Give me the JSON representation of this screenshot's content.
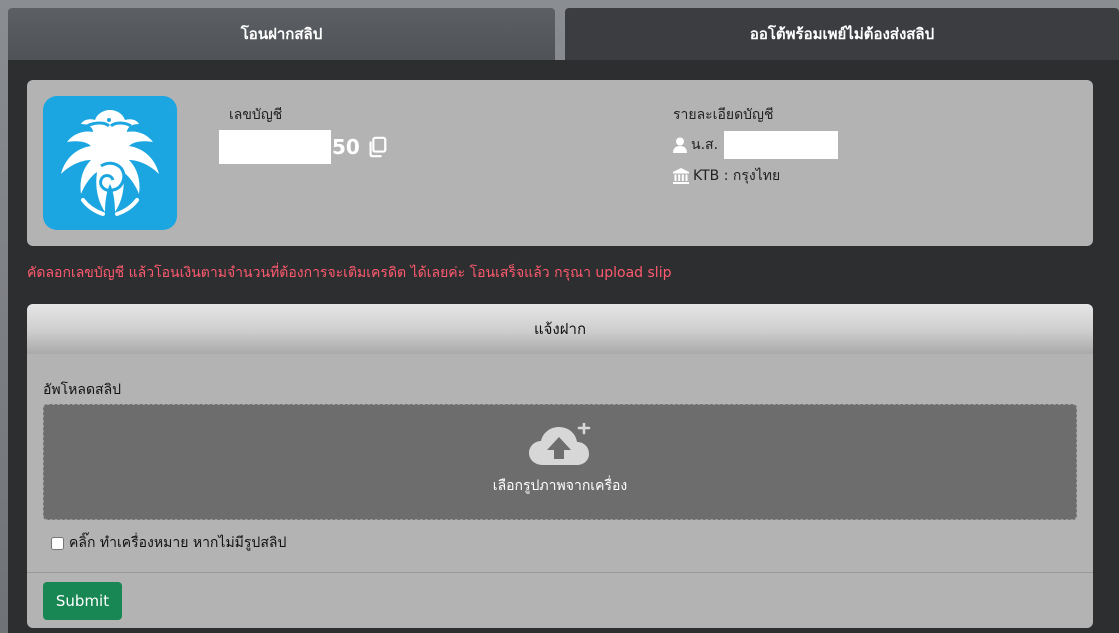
{
  "tabs": [
    {
      "label": "โอนฝากสลิป"
    },
    {
      "label": "ออโต้พร้อมเพย์ไม่ต้องส่งสลิป"
    }
  ],
  "account": {
    "number_label": "เลขบัญชี",
    "number_suffix": "50",
    "details_label": "รายละเอียดบัญชี",
    "name_prefix": "น.ส.",
    "bank": "KTB : กรุงไทย"
  },
  "instruction": "คัดลอกเลขบัญชี แล้วโอนเงินตามจำนวนที่ต้องการจะเติมเครดิต ได้เลยค่ะ โอนเสร็จแล้ว กรุณา upload slip",
  "form": {
    "title": "แจ้งฝาก",
    "upload_label": "อัพโหลดสลิป",
    "dropzone_text": "เลือกรูปภาพจากเครื่อง",
    "checkbox_label": "คลิ๊ก ทำเครื่องหมาย หากไม่มีรูปสลิป",
    "checkbox_checked": false,
    "submit_label": "Submit"
  },
  "colors": {
    "instruction": "#ff5a6e",
    "submit": "#198754",
    "bank_logo_bg": "#1ba6e1"
  },
  "icons": [
    "copy-icon",
    "user-icon",
    "bank-icon",
    "cloud-upload-icon",
    "krungthai-bird-logo"
  ]
}
